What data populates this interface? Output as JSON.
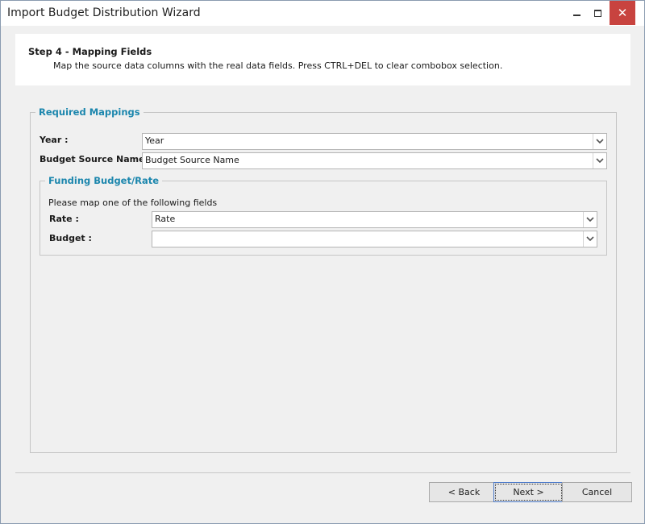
{
  "window": {
    "title": "Import Budget Distribution Wizard",
    "minimize_label": "",
    "maximize_label": "",
    "close_label": "✕"
  },
  "header": {
    "step_title": "Step 4 - Mapping Fields",
    "description": "Map the source data columns with the real data fields. Press CTRL+DEL to clear combobox selection."
  },
  "required_mappings": {
    "legend": "Required Mappings",
    "fields": [
      {
        "label": "Year :",
        "value": "Year"
      },
      {
        "label": "Budget Source Name :",
        "value": "Budget Source Name"
      }
    ]
  },
  "funding": {
    "legend": "Funding Budget/Rate",
    "hint": "Please map one of the following fields",
    "fields": [
      {
        "label": "Rate :",
        "value": "Rate"
      },
      {
        "label": "Budget :",
        "value": ""
      }
    ]
  },
  "footer": {
    "back_label": "< Back",
    "next_label": "Next >",
    "cancel_label": "Cancel"
  },
  "icons": {
    "minimize": "minimize-icon",
    "maximize": "maximize-icon",
    "close": "close-icon",
    "dropdown": "chevron-down-icon"
  }
}
